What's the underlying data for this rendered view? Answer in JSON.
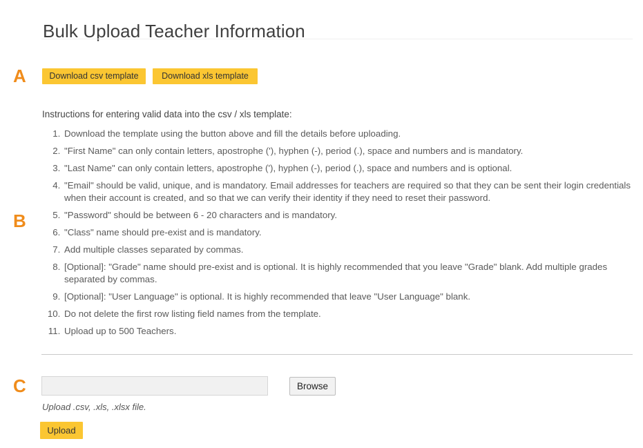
{
  "page": {
    "title": "Bulk Upload Teacher Information"
  },
  "markers": {
    "a": "A",
    "b": "B",
    "c": "C",
    "color": "#f08c1b"
  },
  "templates": {
    "download_csv_label": "Download csv template",
    "download_xls_label": "Download xls template",
    "button_color": "#fbc632"
  },
  "instructions": {
    "heading": "Instructions for entering valid data into the csv / xls template:",
    "items": [
      "Download the template using the button above and fill the details before uploading.",
      "\"First Name\" can only contain letters, apostrophe ('), hyphen (-), period (.), space and numbers and is mandatory.",
      "\"Last Name\" can only contain letters, apostrophe ('), hyphen (-), period (.), space and numbers and is optional.",
      "\"Email\" should be valid, unique, and is mandatory. Email addresses for teachers are required so that they can be sent their login credentials when their account is created, and so that we can verify their identity if they need to reset their password.",
      "\"Password\" should be between 6 - 20 characters and is mandatory.",
      "\"Class\" name should pre-exist and is mandatory.",
      "Add multiple classes separated by commas.",
      "[Optional]: \"Grade\" name should pre-exist and is optional. It is highly recommended that you leave \"Grade\" blank. Add multiple grades separated by commas.",
      "[Optional]: \"User Language\" is optional. It is highly recommended that leave \"User Language\" blank.",
      "Do not delete the first row listing field names from the template.",
      "Upload up to 500 Teachers."
    ]
  },
  "upload": {
    "file_field_value": "",
    "file_field_placeholder": "",
    "browse_label": "Browse",
    "hint": "Upload .csv, .xls, .xlsx file.",
    "upload_label": "Upload"
  }
}
